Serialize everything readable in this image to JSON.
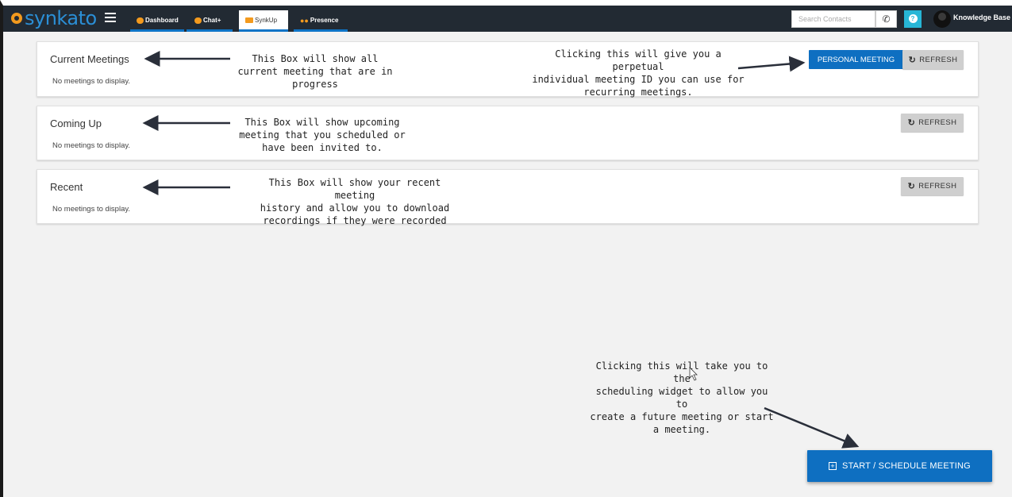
{
  "brand": {
    "name": "synkato"
  },
  "nav": {
    "tabs": [
      {
        "label": "Dashboard",
        "icon": "dashboard-icon"
      },
      {
        "label": "Chat+",
        "icon": "chat-icon"
      },
      {
        "label": "SynkUp",
        "icon": "camera-icon",
        "active": true
      },
      {
        "label": "Presence",
        "icon": "people-icon"
      }
    ],
    "search_placeholder": "Search Contacts",
    "knowledge_base": "Knowledge Base"
  },
  "panels": {
    "current": {
      "title": "Current Meetings",
      "empty": "No meetings to display.",
      "personal_label": "PERSONAL MEETING",
      "refresh_label": "REFRESH"
    },
    "upcoming": {
      "title": "Coming Up",
      "empty": "No meetings to display.",
      "refresh_label": "REFRESH"
    },
    "recent": {
      "title": "Recent",
      "empty": "No meetings to display.",
      "refresh_label": "REFRESH"
    }
  },
  "annotations": {
    "current": [
      "This Box will show all",
      "current meeting that are in",
      "progress"
    ],
    "upcoming": [
      "This Box will show upcoming",
      "meeting that you scheduled or",
      "have been invited to."
    ],
    "recent": [
      "This Box will show your recent meeting",
      "history and allow you to download",
      "recordings if they were recorded"
    ],
    "personal": [
      "Clicking this will give you a perpetual",
      "individual meeting ID you can use for",
      "recurring meetings."
    ],
    "start": [
      "Clicking this will take you to the",
      "scheduling widget to allow you to",
      "create a future meeting or start",
      "a meeting."
    ]
  },
  "start_button": {
    "label": "START / SCHEDULE MEETING"
  },
  "colors": {
    "topbar": "#222a33",
    "brand_blue": "#0e6fc1",
    "accent_orange": "#f39a1e",
    "help": "#27b6d6"
  }
}
